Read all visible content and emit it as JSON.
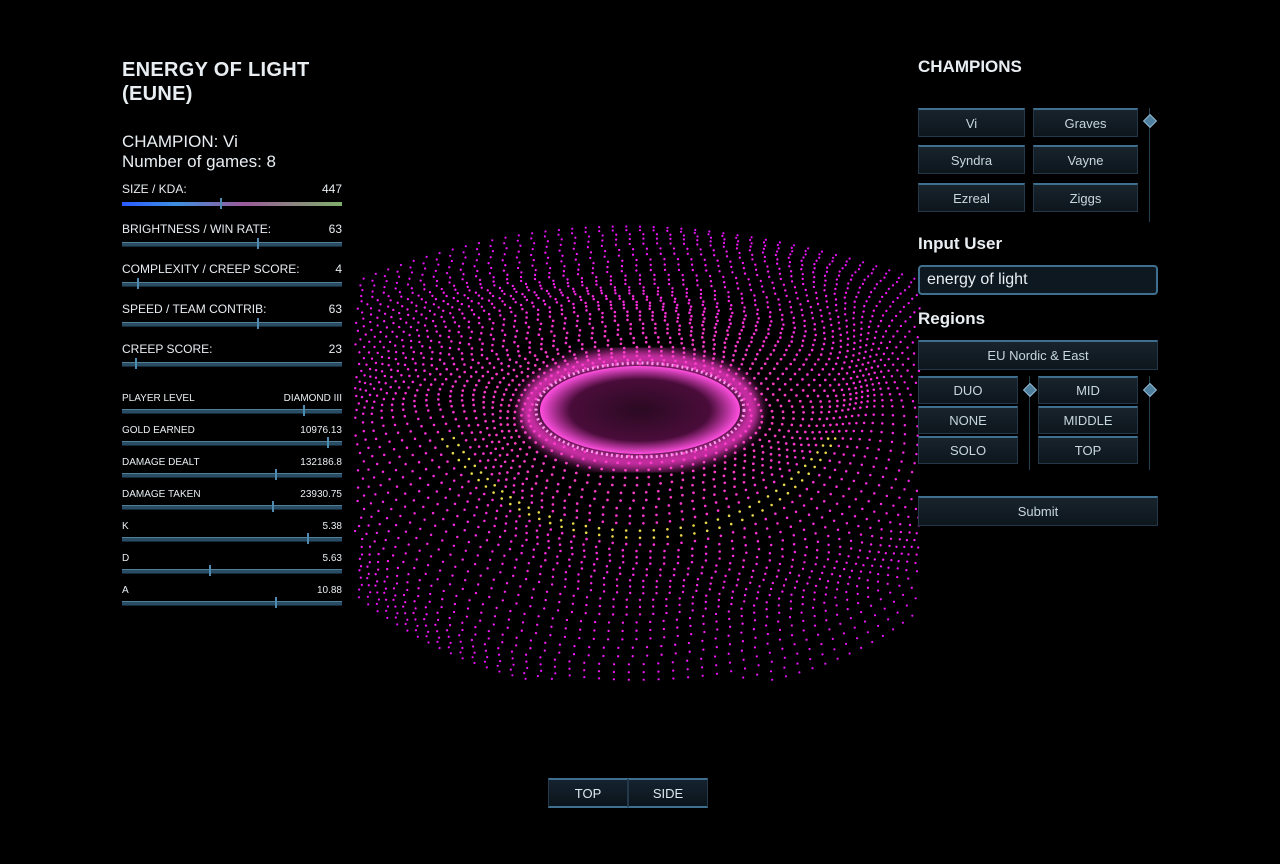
{
  "left": {
    "title": "ENERGY OF LIGHT (EUNE)",
    "champion": "CHAMPION: Vi",
    "games": "Number of games: 8",
    "stats": [
      {
        "label": "SIZE / KDA:",
        "value": "447",
        "fraction": 0.45
      },
      {
        "label": "BRIGHTNESS / WIN RATE:",
        "value": "63",
        "fraction": 0.62
      },
      {
        "label": "COMPLEXITY / CREEP SCORE:",
        "value": "4",
        "fraction": 0.07
      },
      {
        "label": "SPEED / TEAM CONTRIB:",
        "value": "63",
        "fraction": 0.62
      },
      {
        "label": "CREEP SCORE:",
        "value": "23",
        "fraction": 0.06
      }
    ],
    "small_stats": [
      {
        "label": "PLAYER LEVEL",
        "value": "DIAMOND III",
        "fraction": 0.83
      },
      {
        "label": "GOLD EARNED",
        "value": "10976.13",
        "fraction": 0.94
      },
      {
        "label": "DAMAGE DEALT",
        "value": "132186.8",
        "fraction": 0.7
      },
      {
        "label": "DAMAGE TAKEN",
        "value": "23930.75",
        "fraction": 0.69
      },
      {
        "label": "K",
        "value": "5.38",
        "fraction": 0.85
      },
      {
        "label": "D",
        "value": "5.63",
        "fraction": 0.4
      },
      {
        "label": "A",
        "value": "10.88",
        "fraction": 0.7
      }
    ]
  },
  "right": {
    "champions_title": "CHAMPIONS",
    "champions": [
      "Vi",
      "Graves",
      "Syndra",
      "Vayne",
      "Ezreal",
      "Ziggs"
    ],
    "input_title": "Input User",
    "input_value": "energy of light",
    "regions_title": "Regions",
    "region": "EU Nordic & East",
    "queue_options": [
      "DUO",
      "NONE",
      "SOLO"
    ],
    "lane_options": [
      "MID",
      "MIDDLE",
      "TOP"
    ],
    "submit": "Submit"
  },
  "view": {
    "top": "TOP",
    "side": "SIDE"
  },
  "colors": {
    "accent": "#3f6f8f",
    "ring": "#ff3ad0",
    "dots": "#ff2a6a"
  }
}
